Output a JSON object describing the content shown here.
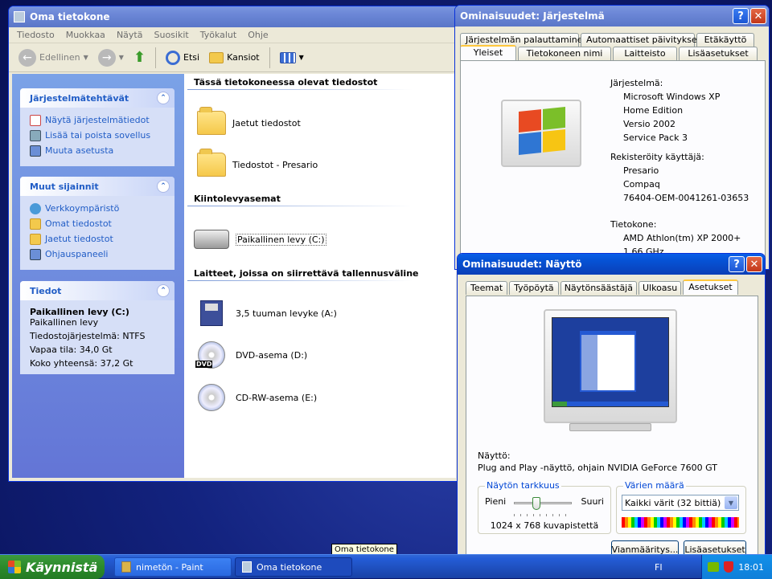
{
  "explorer": {
    "title": "Oma tietokone",
    "menu": [
      "Tiedosto",
      "Muokkaa",
      "Näytä",
      "Suosikit",
      "Työkalut",
      "Ohje"
    ],
    "toolbar": {
      "back": "Edellinen",
      "search": "Etsi",
      "folders": "Kansiot"
    },
    "tasks": {
      "title": "Järjestelmätehtävät",
      "items": [
        "Näytä järjestelmätiedot",
        "Lisää tai poista sovellus",
        "Muuta asetusta"
      ]
    },
    "places": {
      "title": "Muut sijainnit",
      "items": [
        "Verkkoympäristö",
        "Omat tiedostot",
        "Jaetut tiedostot",
        "Ohjauspaneeli"
      ]
    },
    "details": {
      "title": "Tiedot",
      "name": "Paikallinen levy (C:)",
      "type": "Paikallinen levy",
      "fs": "Tiedostojärjestelmä: NTFS",
      "free": "Vapaa tila: 34,0 Gt",
      "total": "Koko yhteensä: 37,2 Gt"
    },
    "groups": {
      "files": "Tässä tietokoneessa olevat tiedostot",
      "drives": "Kiintolevyasemat",
      "removable": "Laitteet, joissa on siirrettävä tallennusväline"
    },
    "files": [
      "Jaetut tiedostot",
      "Tiedostot - Presario"
    ],
    "drives": [
      "Paikallinen levy (C:)"
    ],
    "removable": [
      "3,5 tuuman levyke (A:)",
      "DVD-asema (D:)",
      "CD-RW-asema (E:)"
    ],
    "dvd_label": "DVD"
  },
  "sysprops": {
    "title": "Ominaisuudet: Järjestelmä",
    "tabs_row1": [
      "Järjestelmän palauttaminen",
      "Automaattiset päivitykset",
      "Etäkäyttö"
    ],
    "tabs_row2": [
      "Yleiset",
      "Tietokoneen nimi",
      "Laitteisto",
      "Lisäasetukset"
    ],
    "system_label": "Järjestelmä:",
    "system": [
      "Microsoft Windows XP",
      "Home Edition",
      "Versio 2002",
      "Service Pack 3"
    ],
    "registered_label": "Rekisteröity käyttäjä:",
    "registered": [
      "Presario",
      "Compaq",
      "76404-OEM-0041261-03653"
    ],
    "computer_label": "Tietokone:",
    "computer": [
      "AMD Athlon(tm) XP 2000+",
      "1.66 GHz"
    ]
  },
  "display": {
    "title": "Ominaisuudet: Näyttö",
    "tabs": [
      "Teemat",
      "Työpöytä",
      "Näytönsäästäjä",
      "Ulkoasu",
      "Asetukset"
    ],
    "display_label": "Näyttö:",
    "display_value": "Plug and Play -näyttö, ohjain NVIDIA GeForce 7600 GT",
    "resolution_title": "Näytön tarkkuus",
    "res_low": "Pieni",
    "res_high": "Suuri",
    "resolution": "1024 x 768 kuvapistettä",
    "resolution_level": 0.38,
    "colors_title": "Värien määrä",
    "colors_value": "Kaikki värit (32 bittiä)",
    "btn_troubleshoot": "Vianmääritys...",
    "btn_advanced": "Lisäasetukset"
  },
  "tooltip": "Oma tietokone",
  "taskbar": {
    "start": "Käynnistä",
    "buttons": [
      "nimetön - Paint",
      "Oma tietokone"
    ],
    "lang": "FI",
    "time": "18:01"
  }
}
